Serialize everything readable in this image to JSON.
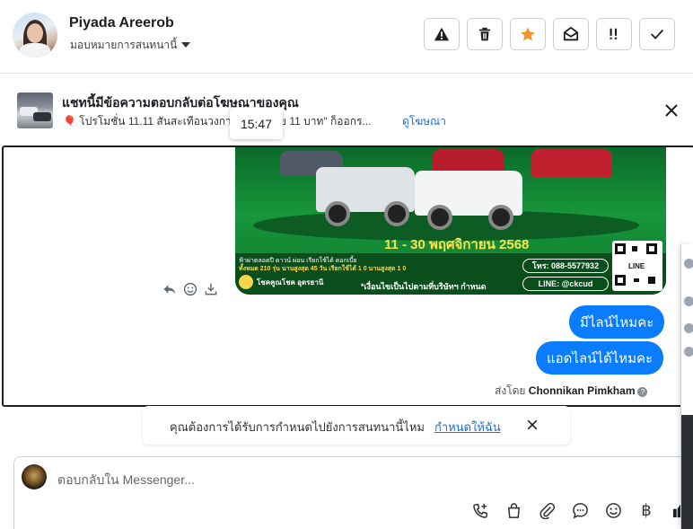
{
  "header": {
    "name": "Piyada Areerob",
    "assign_label": "มอบหมายการสนทนานี้",
    "toolbar": [
      "alert-icon",
      "trash-icon",
      "star-icon",
      "mark-unread-icon",
      "priority-icon",
      "check-icon"
    ],
    "star_color": "#f0932b"
  },
  "ad": {
    "title": "แชทนี้มีข้อความตอบกลับต่อโฆษณาของคุณ",
    "subtitle": "🎈 โปรโมชั่น 11.11 สันสะเทือนวงการ! รับ... จ่าย 11 บาท\" ก็ออกร...",
    "link": "ดูโฆษณา",
    "tooltip_time": "15:47"
  },
  "banner": {
    "dates": "11 - 30 พฤศจิกายน 2568",
    "info_line1": "ฟ้าผ่าตลอดปี   ดาวน์  ผ่อน   เรียกใช้ได้  ดอกเบี้ย",
    "info_line2": "ทั้งหมด 210 รุ่น   นานสูงสุด 45 วัน   เรียกใช้ได้ 1 0   นานสูงสุด 1 0",
    "brand": "โชคคูณโชค อุดรธานี",
    "terms": "*เงื่อนไขเป็นไปตามที่บริษัทฯ กำหนด",
    "tel": "โทร: 088-5577932",
    "line_id": "LINE: @ckcud",
    "qr_label": "LINE"
  },
  "messages": [
    {
      "text": "มีไลน์ไหมคะ"
    },
    {
      "text": "แอดไลน์ได้ไหมคะ"
    }
  ],
  "sent_by_prefix": "ส่งโดย",
  "sent_by_name": "Chonnikan Pimkham",
  "prompt": {
    "text": "คุณต้องการได้รับการกำหนดไปยังการสนทนานี้ไหม",
    "link": "กำหนดให้ฉัน"
  },
  "composer": {
    "placeholder": "ตอบกลับใน Messenger...",
    "tools": [
      "call-add-icon",
      "shop-bag-icon",
      "attach-icon",
      "chat-bubble-icon",
      "emoji-icon",
      "baht-icon",
      "like-icon"
    ],
    "baht_symbol": "฿"
  },
  "colors": {
    "accent": "#0a7cff",
    "link": "#216fdb"
  }
}
